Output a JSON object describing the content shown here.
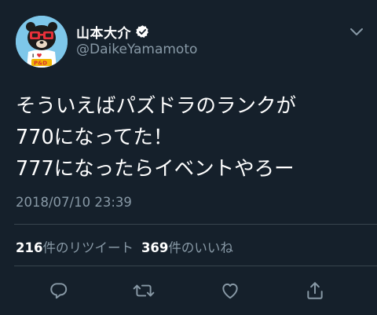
{
  "user": {
    "display_name": "山本大介",
    "handle": "@DaikeYamamoto",
    "verified": true
  },
  "tweet": {
    "lines": [
      "そういえばパズドラのランクが",
      "770になってた！",
      "777になったらイベントやろー"
    ],
    "timestamp": "2018/07/10 23:39"
  },
  "stats": {
    "retweets_count": "216",
    "retweets_label": "件のリツイート",
    "likes_count": "369",
    "likes_label": "件のいいね"
  },
  "icons": {
    "reply": "reply-icon",
    "retweet": "retweet-icon",
    "like": "heart-icon",
    "share": "share-icon",
    "menu": "chevron-down-icon",
    "verified": "verified-badge-icon"
  },
  "colors": {
    "background": "#15202b",
    "secondary_text": "#8899a6",
    "divider": "#38444d",
    "icon": "#8899a6",
    "avatar_bg": "#7ec7ea"
  }
}
